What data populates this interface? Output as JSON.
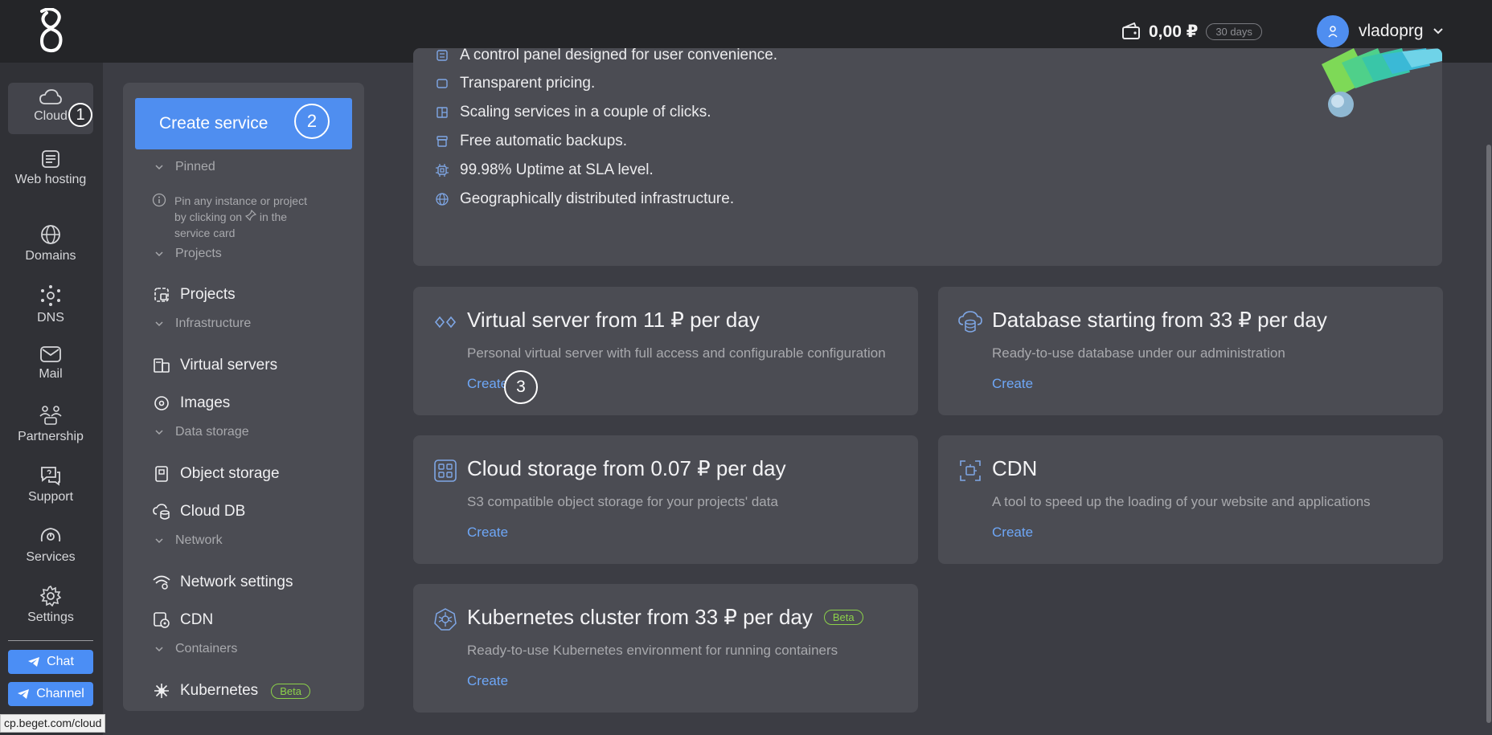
{
  "header": {
    "balance": "0,00 ₽",
    "days_badge": "30 days",
    "username": "vladoprg"
  },
  "leftnav": {
    "items": [
      {
        "label": "Cloud",
        "icon": "cloud-icon"
      },
      {
        "label": "Web hosting",
        "icon": "web-hosting-icon"
      },
      {
        "label": "Domains",
        "icon": "globe-icon"
      },
      {
        "label": "DNS",
        "icon": "dns-icon"
      },
      {
        "label": "Mail",
        "icon": "mail-icon"
      },
      {
        "label": "Partnership",
        "icon": "partnership-icon"
      },
      {
        "label": "Support",
        "icon": "support-icon"
      },
      {
        "label": "Services",
        "icon": "services-icon"
      },
      {
        "label": "Settings",
        "icon": "gear-icon"
      }
    ],
    "chat_label": "Chat",
    "channel_label": "Channel"
  },
  "callouts": [
    "1",
    "2",
    "3"
  ],
  "sidepanel": {
    "create_label": "Create service",
    "sections": {
      "pinned": "Pinned",
      "projects": "Projects",
      "infrastructure": "Infrastructure",
      "data_storage": "Data storage",
      "network": "Network",
      "containers": "Containers"
    },
    "pin_hint": "Pin any instance or project by clicking on",
    "pin_hint_end": "in the service card",
    "items": {
      "projects": "Projects",
      "virtual_servers": "Virtual servers",
      "images": "Images",
      "object_storage": "Object storage",
      "cloud_db": "Cloud DB",
      "network_settings": "Network settings",
      "cdn": "CDN",
      "kubernetes": "Kubernetes"
    },
    "beta_label": "Beta"
  },
  "features": [
    "A control panel designed for user convenience.",
    "Transparent pricing.",
    "Scaling services in a couple of clicks.",
    "Free automatic backups.",
    "99.98% Uptime at SLA level.",
    "Geographically distributed infrastructure."
  ],
  "cards": {
    "vps": {
      "title": "Virtual server from 11 ₽ per day",
      "desc": "Personal virtual server with full access and configurable configuration",
      "link": "Create"
    },
    "db": {
      "title": "Database starting from 33 ₽ per day",
      "desc": "Ready-to-use database under our administration",
      "link": "Create"
    },
    "storage": {
      "title": "Cloud storage from 0.07 ₽ per day",
      "desc": "S3 compatible object storage for your projects' data",
      "link": "Create"
    },
    "cdn": {
      "title": "CDN",
      "desc": "A tool to speed up the loading of your website and applications",
      "link": "Create"
    },
    "k8s": {
      "title": "Kubernetes cluster from 33 ₽ per day",
      "desc": "Ready-to-use Kubernetes environment for running containers",
      "link": "Create",
      "badge": "Beta"
    }
  },
  "status_url": "cp.beget.com/cloud",
  "colors": {
    "accent": "#4f8ef0",
    "link": "#6ea7f7",
    "beta": "#8cd14a"
  }
}
